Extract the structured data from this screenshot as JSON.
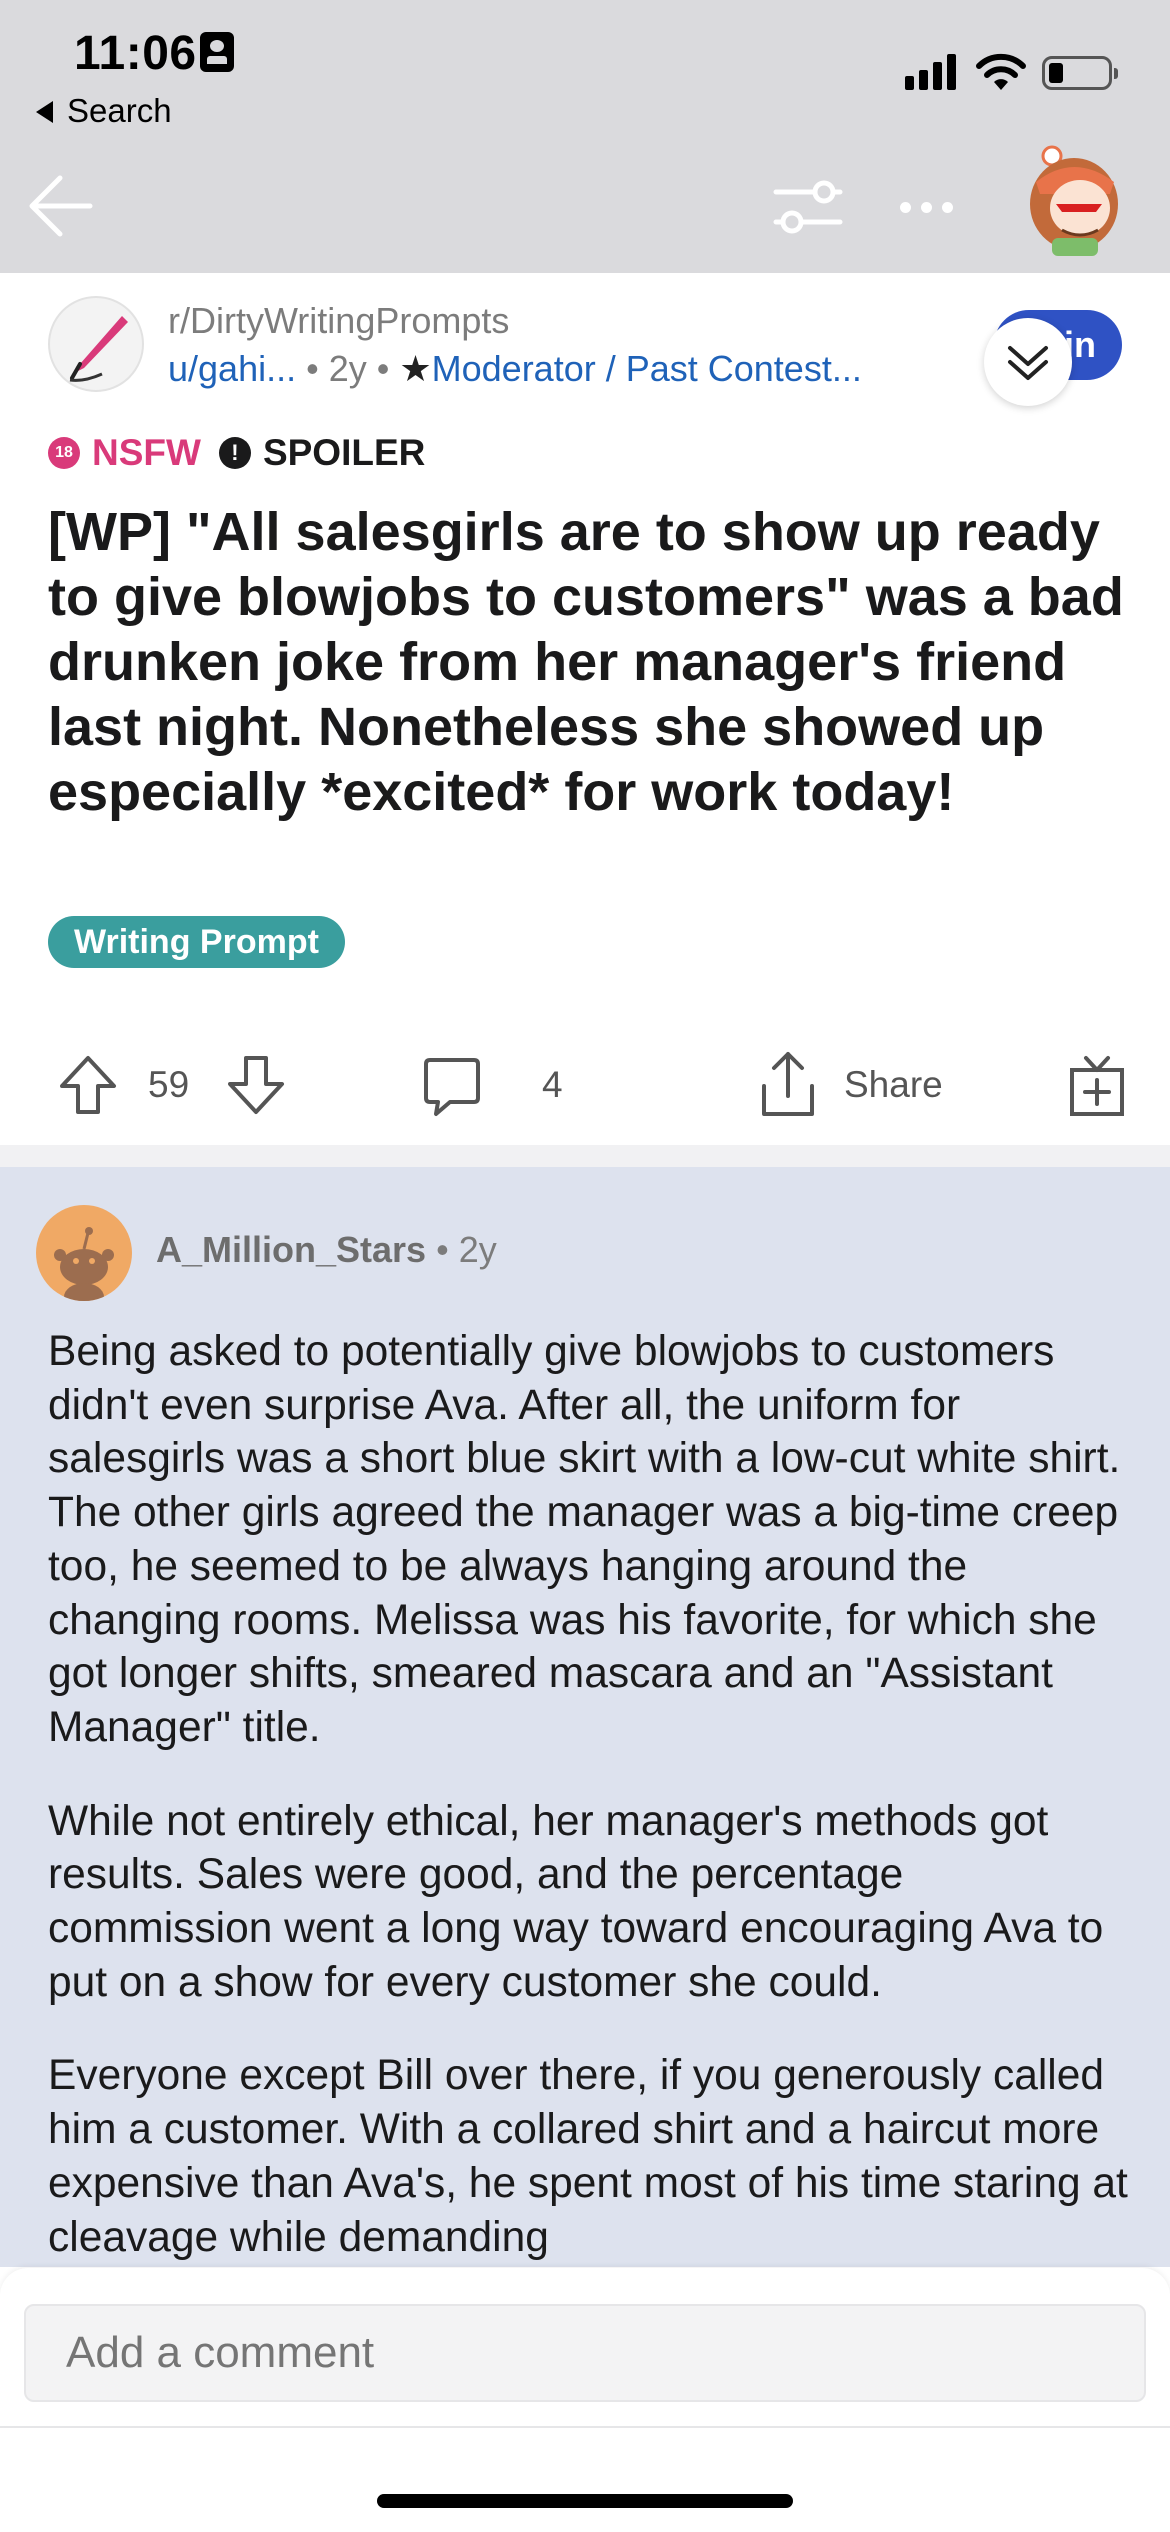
{
  "status_bar": {
    "time": "11:06",
    "back_app": "Search"
  },
  "nav": {
    "back_icon": "arrow-left-icon",
    "filter_icon": "sliders-icon",
    "more_icon": "ellipsis-icon",
    "avatar_icon": "user-avatar-icon"
  },
  "post": {
    "subreddit": "r/DirtyWritingPrompts",
    "author": "u/gahi...",
    "age": "2y",
    "author_flair": "Moderator / Past Contest...",
    "join_label": "in",
    "tag_nsfw": "NSFW",
    "tag_nsfw_badge": "18",
    "tag_spoiler": "SPOILER",
    "title": "[WP] \"All salesgirls are to show up ready to give blowjobs to customers\" was a bad drunken joke from her manager's friend last night. Nonetheless she showed up especially *excited* for work today!",
    "flair": "Writing Prompt",
    "score": "59",
    "comments_count": "4",
    "share_label": "Share"
  },
  "comment": {
    "author": "A_Million_Stars",
    "age": "2y",
    "paragraphs": [
      "Being asked to potentially give blowjobs to customers didn't even surprise Ava. After all, the uniform for salesgirls was a short blue skirt with a low-cut white shirt. The other girls agreed the manager was a big-time creep too, he seemed to be always hanging around the changing rooms. Melissa was his favorite, for which she got longer shifts, smeared mascara and an \"Assistant Manager\" title.",
      "While not entirely ethical, her manager's methods got results. Sales were good, and the percentage commission went a long way toward encouraging Ava to put on a show for every customer she could.",
      "Everyone except Bill over there, if you generously called him a customer. With a collared shirt and a haircut more expensive than Ava's, he spent most of his time staring at cleavage while demanding"
    ]
  },
  "composer": {
    "placeholder": "Add a comment"
  },
  "colors": {
    "accent": "#2f52c4",
    "nsfw": "#d93a7a",
    "flair": "#3a9e9e",
    "link": "#1f62b8",
    "comment_bg": "#dde2ee"
  }
}
